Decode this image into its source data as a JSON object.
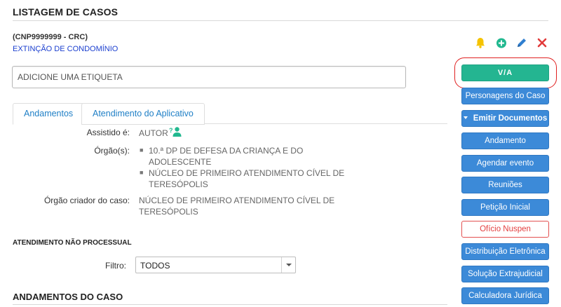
{
  "page": {
    "title": "LISTAGEM DE CASOS"
  },
  "case": {
    "code": "(CNP9999999 - CRC)",
    "type": "EXTINÇÃO DE CONDOMÍNIO"
  },
  "actions": {
    "icons": [
      "bell-icon",
      "add-circle-icon",
      "pencil-icon",
      "close-icon"
    ],
    "colors": {
      "bell": "#f5c300",
      "add": "#21b88f",
      "edit": "#2f7fd0",
      "close": "#e23b3b"
    }
  },
  "tag": {
    "placeholder": "ADICIONE UMA ETIQUETA"
  },
  "tabs": [
    {
      "label": "Andamentos",
      "active": true
    },
    {
      "label": "Atendimento do Aplicativo",
      "active": false
    }
  ],
  "details": {
    "assistido_label": "Assistido é:",
    "assistido_value": "AUTOR",
    "orgaos_label": "Órgão(s):",
    "orgaos": [
      {
        "line1": "10.ª DP DE DEFESA DA CRIANÇA E DO",
        "line2": "ADOLESCENTE"
      },
      {
        "line1": "NÚCLEO DE PRIMEIRO ATENDIMENTO CÍVEL DE",
        "line2": "TERESÓPOLIS"
      }
    ],
    "criador_label": "Órgão criador do caso:",
    "criador_line1": "NÚCLEO DE PRIMEIRO ATENDIMENTO CÍVEL DE",
    "criador_line2": "TERESÓPOLIS"
  },
  "nao_processual": {
    "title": "ATENDIMENTO NÃO PROCESSUAL",
    "filter_label": "Filtro:",
    "filter_value": "TODOS"
  },
  "andamentos_section": {
    "title": "ANDAMENTOS DO CASO"
  },
  "sidebar": {
    "via_label": "V/A",
    "buttons": [
      "Personagens do Caso",
      "Emitir Documentos",
      "Andamento",
      "Agendar evento",
      "Reuniões",
      "Petição Inicial",
      "Ofício Nuspen",
      "Distribuição Eletrônica",
      "Solução Extrajudicial",
      "Calculadora Jurídica"
    ]
  }
}
